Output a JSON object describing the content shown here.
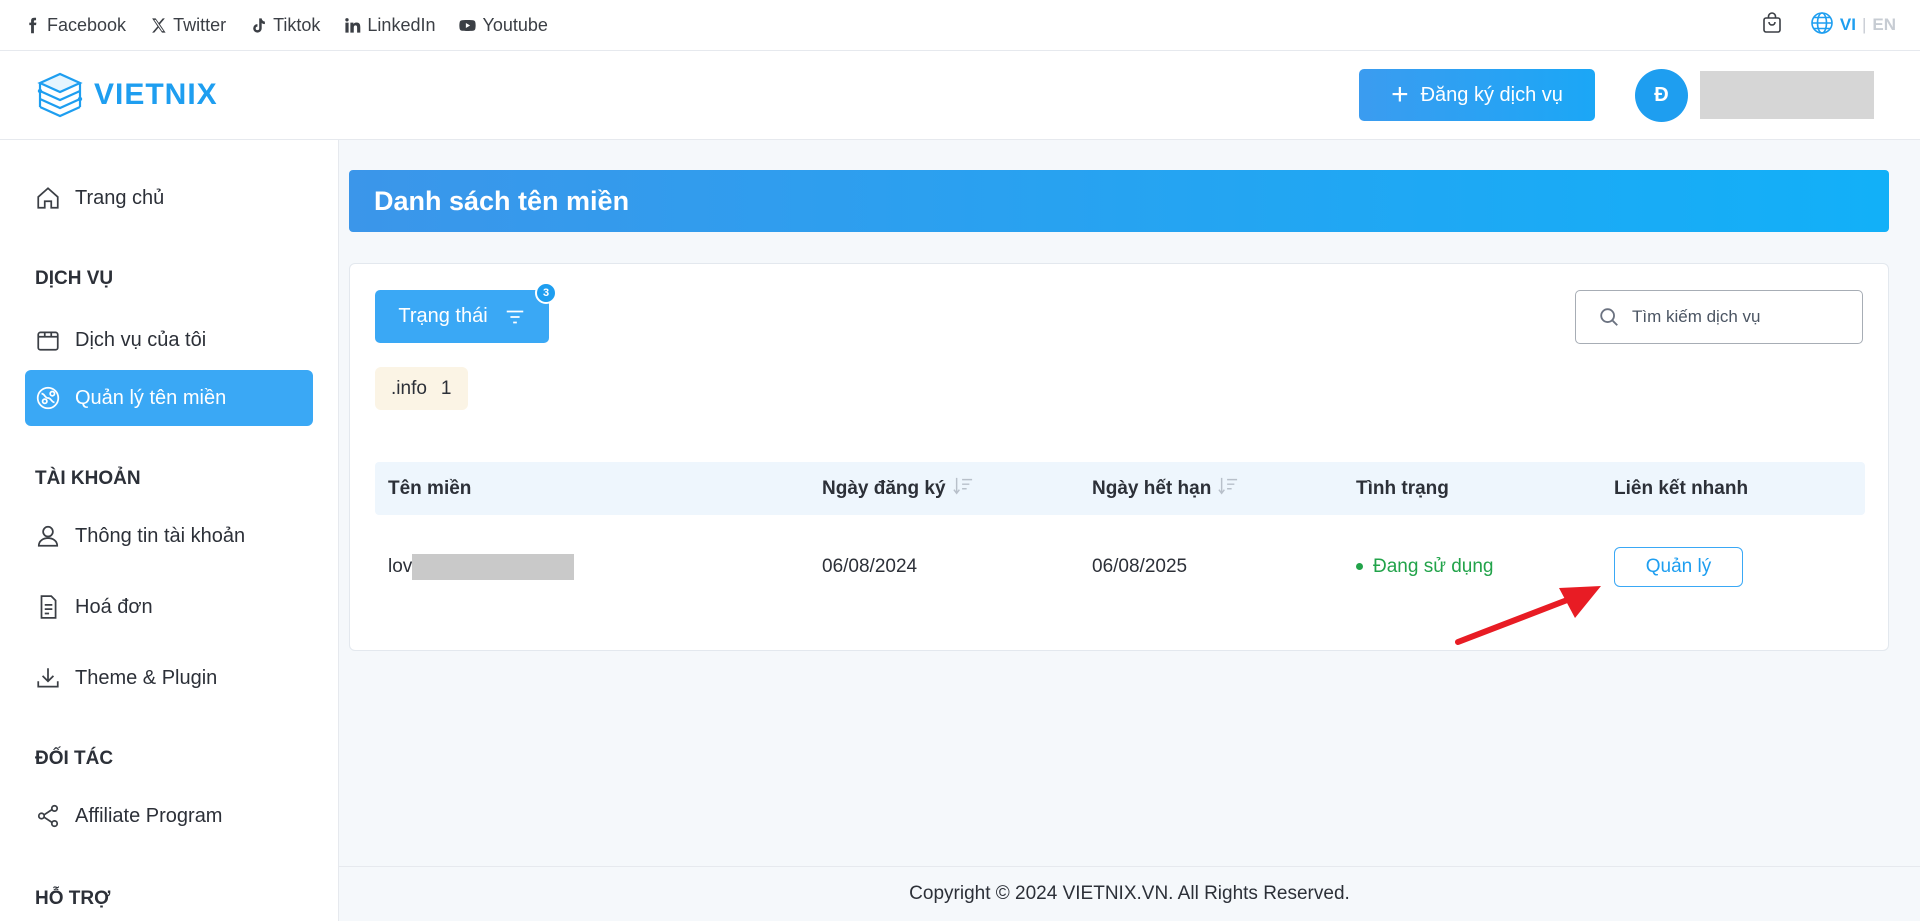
{
  "social": {
    "links": [
      {
        "label": "Facebook",
        "icon": "facebook-icon"
      },
      {
        "label": "Twitter",
        "icon": "x-twitter-icon"
      },
      {
        "label": "Tiktok",
        "icon": "tiktok-icon"
      },
      {
        "label": "LinkedIn",
        "icon": "linkedin-icon"
      },
      {
        "label": "Youtube",
        "icon": "youtube-icon"
      }
    ],
    "lang_vi": "VI",
    "lang_sep": "|",
    "lang_en": "EN"
  },
  "header": {
    "logo_text": "VIETNIX",
    "register_label": "Đăng ký dịch vụ",
    "avatar_initial": "Đ"
  },
  "sidebar": {
    "home": "Trang chủ",
    "section_services": "DỊCH VỤ",
    "my_services": "Dịch vụ của tôi",
    "domain_manage": "Quản lý tên miền",
    "section_account": "TÀI KHOẢN",
    "account_info": "Thông tin tài khoản",
    "invoice": "Hoá đơn",
    "theme_plugin": "Theme & Plugin",
    "section_partner": "ĐỐI TÁC",
    "affiliate": "Affiliate Program",
    "section_support": "HỖ TRỢ"
  },
  "main": {
    "title": "Danh sách tên miền",
    "filter_label": "Trạng thái",
    "filter_count": "3",
    "search_placeholder": "Tìm kiếm dịch vụ",
    "tld_chip": {
      "label": ".info",
      "count": "1"
    },
    "table": {
      "headers": [
        "Tên miền",
        "Ngày đăng ký",
        "Ngày hết hạn",
        "Tình trạng",
        "Liên kết nhanh"
      ],
      "rows": [
        {
          "domain_prefix": "lov",
          "registered": "06/08/2024",
          "expires": "06/08/2025",
          "status": "Đang sử dụng",
          "action": "Quản lý"
        }
      ]
    }
  },
  "footer": {
    "copyright": "Copyright © 2024 VIETNIX.VN. All Rights Reserved."
  },
  "colors": {
    "brand": "#1e9ef0",
    "status_active": "#22a34a",
    "annotation_arrow": "#e81c24"
  }
}
